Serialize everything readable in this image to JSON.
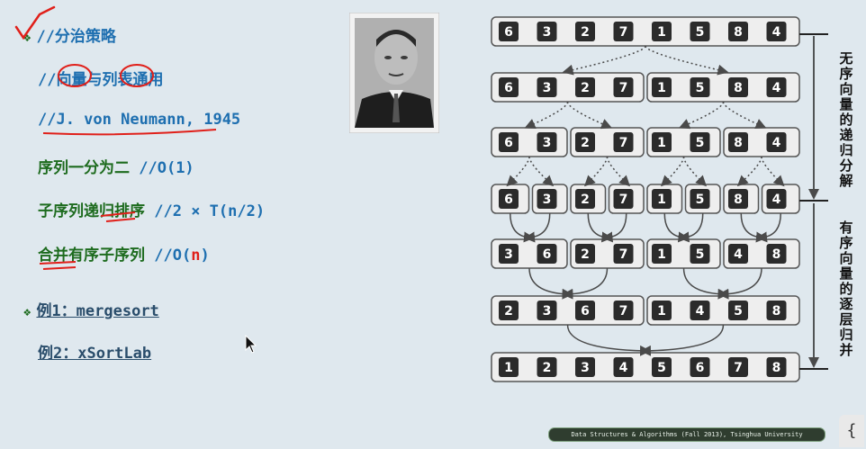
{
  "slide": {
    "lines": [
      {
        "bullet": "❖",
        "text": "//分治策略"
      },
      {
        "text": "//向量与列表通用"
      },
      {
        "text": "//J. von Neumann, 1945"
      },
      {
        "code": "序列一分为二",
        "comment": "//O(1)"
      },
      {
        "code": "子序列递归排序",
        "comment": "//2 × T(n/2)"
      },
      {
        "code": "合并有序子序列",
        "comment_prefix": "//O(",
        "comment_highlight": "n",
        "comment_suffix": ")"
      },
      {
        "bullet": "❖",
        "link": "例1：mergesort"
      },
      {
        "link": "例2：xSortLab"
      }
    ]
  },
  "diagram": {
    "rows": [
      {
        "groups": [
          [
            "6",
            "3",
            "2",
            "7",
            "1",
            "5",
            "8",
            "4"
          ]
        ]
      },
      {
        "groups": [
          [
            "6",
            "3",
            "2",
            "7"
          ],
          [
            "1",
            "5",
            "8",
            "4"
          ]
        ]
      },
      {
        "groups": [
          [
            "6",
            "3"
          ],
          [
            "2",
            "7"
          ],
          [
            "1",
            "5"
          ],
          [
            "8",
            "4"
          ]
        ]
      },
      {
        "groups": [
          [
            "6"
          ],
          [
            "3"
          ],
          [
            "2"
          ],
          [
            "7"
          ],
          [
            "1"
          ],
          [
            "5"
          ],
          [
            "8"
          ],
          [
            "4"
          ]
        ]
      },
      {
        "groups": [
          [
            "3",
            "6"
          ],
          [
            "2",
            "7"
          ],
          [
            "1",
            "5"
          ],
          [
            "4",
            "8"
          ]
        ]
      },
      {
        "groups": [
          [
            "2",
            "3",
            "6",
            "7"
          ],
          [
            "1",
            "4",
            "5",
            "8"
          ]
        ]
      },
      {
        "groups": [
          [
            "1",
            "2",
            "3",
            "4",
            "5",
            "6",
            "7",
            "8"
          ]
        ]
      }
    ],
    "side_label_top": "无序向量的递归分解",
    "side_label_bottom": "有序向量的逐层归并",
    "colors": {
      "cell": "#2b2b2b",
      "group_bg": "#eeeeee",
      "group_border": "#555555",
      "arrow": "#4a4a4a"
    }
  },
  "footer": "Data Structures & Algorithms (Fall 2013), Tsinghua University",
  "corner_icon": "{"
}
